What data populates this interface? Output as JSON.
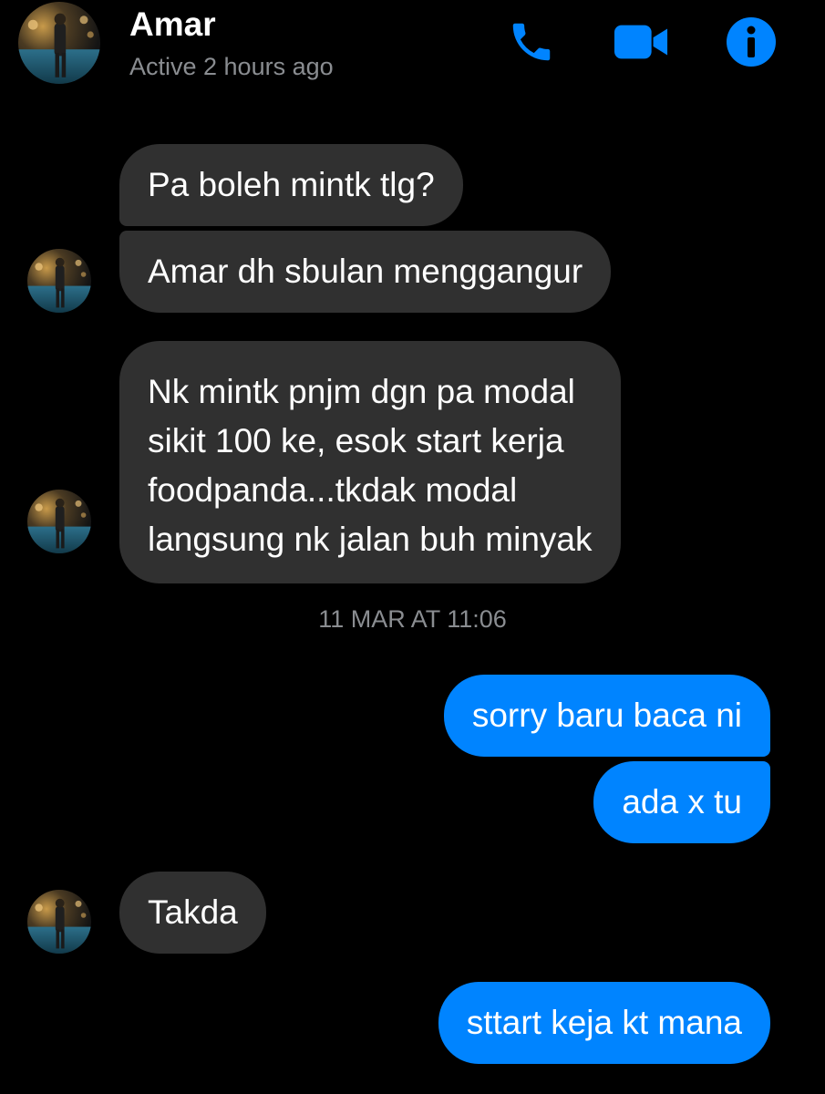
{
  "header": {
    "name": "Amar",
    "status": "Active 2 hours ago",
    "actions": [
      "phone-icon",
      "video-camera-icon",
      "info-icon"
    ],
    "accent_color": "#0084ff"
  },
  "messages": {
    "m1": "Pa boleh mintk tlg?",
    "m2": "Amar dh sbulan menggangur",
    "m3": "Nk mintk pnjm dgn pa modal\nsikit 100 ke,  esok start kerja\nfoodpanda...tkdak modal\nlangsung nk jalan buh minyak",
    "timestamp": "11 MAR AT 11:06",
    "m4": "sorry baru baca ni",
    "m5": "ada x tu",
    "m6": "Takda",
    "m7": "sttart keja kt mana"
  },
  "colors": {
    "incoming_bubble": "#303030",
    "outgoing_bubble": "#0084ff",
    "secondary_text": "#8a8d91",
    "background": "#000000"
  }
}
